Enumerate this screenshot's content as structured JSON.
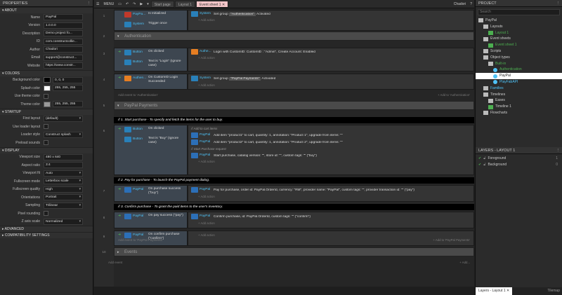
{
  "properties": {
    "title": "PROPERTIES",
    "sections": {
      "about": "ABOUT",
      "colors": "COLORS",
      "startup": "STARTUP",
      "display": "DISPLAY",
      "advanced": "ADVANCED",
      "compat": "COMPATIBILITY SETTINGS"
    },
    "about": [
      {
        "label": "Name",
        "value": "PayPal"
      },
      {
        "label": "Version",
        "value": "1.0.0.0"
      },
      {
        "label": "Description",
        "value": "Demo project fo..."
      },
      {
        "label": "ID",
        "value": "com.constructcollie..."
      },
      {
        "label": "Author",
        "value": "Chadori"
      },
      {
        "label": "Email",
        "value": "support@construct..."
      },
      {
        "label": "Website",
        "value": "https://www.constr..."
      }
    ],
    "colors": [
      {
        "label": "Background color",
        "value": "0, 0, 0",
        "swatch": "#000000"
      },
      {
        "label": "Splash color",
        "value": "255, 255, 255",
        "swatch": "#ffffff"
      },
      {
        "label": "Use theme color",
        "value": ""
      },
      {
        "label": "Theme color",
        "value": "255, 255, 255",
        "swatch": "#9a9a9a"
      }
    ],
    "startup": [
      {
        "label": "First layout",
        "value": "(default)"
      },
      {
        "label": "Use loader layout",
        "value": ""
      },
      {
        "label": "Loader style",
        "value": "Construct splash"
      },
      {
        "label": "Preload sounds",
        "value": ""
      }
    ],
    "display": [
      {
        "label": "Viewport size",
        "value": "480 x 640"
      },
      {
        "label": "Aspect ratio",
        "value": "3:4"
      },
      {
        "label": "Viewport fit",
        "value": "Auto"
      },
      {
        "label": "Fullscreen mode",
        "value": "Letterbox scale"
      },
      {
        "label": "Fullscreen quality",
        "value": "High"
      },
      {
        "label": "Orientations",
        "value": "Portrait"
      },
      {
        "label": "Sampling",
        "value": "Trilinear"
      },
      {
        "label": "Pixel rounding",
        "value": ""
      },
      {
        "label": "Z axis scale",
        "value": "Normalized"
      }
    ]
  },
  "toolbar": {
    "menu": "MENU",
    "tabs": [
      "Start page",
      "Layout 1",
      "Event sheet 1"
    ],
    "close_glyph": "✕",
    "user": "Chadori"
  },
  "sheet": {
    "rows": [
      "1",
      "2",
      "3",
      "4",
      "5",
      "6",
      "7",
      "8",
      "9",
      "10"
    ],
    "ev1": {
      "c1_obj": "PayPa...",
      "c1_text": "Is Initialized",
      "c2_obj": "System",
      "c2_text": "Trigger once",
      "a1_obj": "System",
      "a1_text": "Set group",
      "a1_value": "\"Authentication\"",
      "a1_suffix": "Activated",
      "add": "+ Add action"
    },
    "group_auth": "Authentication",
    "ev2": {
      "c1_obj": "Button",
      "c1_text": "On clicked",
      "c2_obj": "Button",
      "c2_text": "Text is \"Login\" (Ignore case)",
      "a1_obj": "Authe...",
      "a1_text": "Login with CustomID: CustomID : \"Admin\", Create Account: Enabled",
      "add": "+ Add action"
    },
    "ev3": {
      "c1_obj": "Authen...",
      "c1_text": "On CustomID Login Succeeded",
      "a1_obj": "System",
      "a1_text": "Set group",
      "a1_value": "\"PayPal Payments\"",
      "a1_suffix": "Activated",
      "add": "+ Add action"
    },
    "add_to_auth": "Add event to 'Authentication'",
    "add_to_auth_r": "+ Add to 'Authentication'",
    "group_paypal": "PayPal Payments",
    "comment1": "// 1. Start purchase - To specify and fetch the items for the user to buy.",
    "ev4": {
      "c1_obj": "Button",
      "c1_text": "On clicked",
      "c2_obj": "Button",
      "c2_text": "Text is \"Buy\" (Ignore case)",
      "sub1": "// Add to cart items",
      "a1_obj": "PayPal",
      "a1_text": "Add item \"product1\" to cart, quantity: 1, annotation: \"Product 1\", upgrade from items: \"\"",
      "a2_obj": "PayPal",
      "a2_text": "Add item \"product2\" to cart, quantity: 1, annotation: \"Product 2\", upgrade from items: \"\"",
      "sub2": "// Start Purchase request",
      "a3_obj": "PayPal",
      "a3_text": "Start purchase, catalog version: \"\", store id: \"\", custom tags: \"\" (\"buy\")",
      "add": "+ Add action"
    },
    "comment2": "// 2. Pay for purchase - To launch the PayPal payment dialog.",
    "ev5": {
      "c1_obj": "PayPal",
      "c1_text": "On purchase success (\"buy\")",
      "a1_obj": "PayPal",
      "a1_text": "Pay for purchase, order id: PayPal.OrderId, currency: \"RM\", provider name: \"PayPal\", custom tags: \"\", provider transaction id: \"\" (\"pay\")",
      "add": "+ Add action"
    },
    "comment3": "// 3. Confirm purchase - To grant the paid items to the user's inventory.",
    "ev6": {
      "c1_obj": "PayPal",
      "c1_text": "On pay success (\"pay\")",
      "a1_obj": "PayPal",
      "a1_text": "Confirm purchase, id: PayPal.OrderId, custom tags: \"\" (\"confirm\")",
      "add": "+ Add action"
    },
    "ev7": {
      "c1_obj": "PayPal",
      "c1_text": "On confirm purchase (\"confirm\")",
      "add": "+ Add action"
    },
    "add_to_paypal": "Add event to 'PayPal Payments'",
    "add_to_paypal_r": "+ Add to 'PayPal Payments'",
    "group_events": "Events",
    "add_event": "Add event",
    "add_r": "+ Add..."
  },
  "project": {
    "title": "PROJECT",
    "search_placeholder": "Search",
    "items": [
      {
        "label": "PayPal",
        "indent": 0,
        "color": "#cccccc",
        "icon": "folder"
      },
      {
        "label": "Layouts",
        "indent": 1,
        "color": "#cccccc",
        "icon": "folder"
      },
      {
        "label": "Layout 1",
        "indent": 2,
        "color": "#4caf50",
        "icon": "layout"
      },
      {
        "label": "Event sheets",
        "indent": 1,
        "color": "#cccccc",
        "icon": "folder"
      },
      {
        "label": "Event sheet 1",
        "indent": 2,
        "color": "#4caf50",
        "icon": "sheet"
      },
      {
        "label": "Scripts",
        "indent": 1,
        "color": "#cccccc",
        "icon": "folder"
      },
      {
        "label": "Object types",
        "indent": 1,
        "color": "#cccccc",
        "icon": "folder"
      },
      {
        "label": "Built-in",
        "indent": 2,
        "color": "#4caf50",
        "icon": "folder"
      },
      {
        "label": "Authentication",
        "indent": 3,
        "color": "#4caf50",
        "icon": "obj"
      },
      {
        "label": "PayPal",
        "indent": 3,
        "color": "#222222",
        "icon": "obj",
        "selected": true
      },
      {
        "label": "PlayFabAPI",
        "indent": 3,
        "color": "#4fc3f7",
        "icon": "obj"
      },
      {
        "label": "Families",
        "indent": 1,
        "color": "#4fc3f7",
        "icon": "folder"
      },
      {
        "label": "Timelines",
        "indent": 1,
        "color": "#cccccc",
        "icon": "folder"
      },
      {
        "label": "Eases",
        "indent": 2,
        "color": "#cccccc",
        "icon": "folder"
      },
      {
        "label": "Timeline 1",
        "indent": 2,
        "color": "#cccccc",
        "icon": "sheet"
      },
      {
        "label": "Flowcharts",
        "indent": 1,
        "color": "#cccccc",
        "icon": "folder"
      }
    ]
  },
  "layers": {
    "title": "LAYERS - LAYOUT 1",
    "items": [
      {
        "label": "Foreground",
        "num": "1"
      },
      {
        "label": "Background",
        "num": "0"
      }
    ],
    "tabs": [
      "Layers - Layout 1",
      "Tilemap"
    ]
  },
  "colors": {
    "accent": "#f3c5c8",
    "link": "#4fc3f7",
    "green": "#4caf50"
  }
}
